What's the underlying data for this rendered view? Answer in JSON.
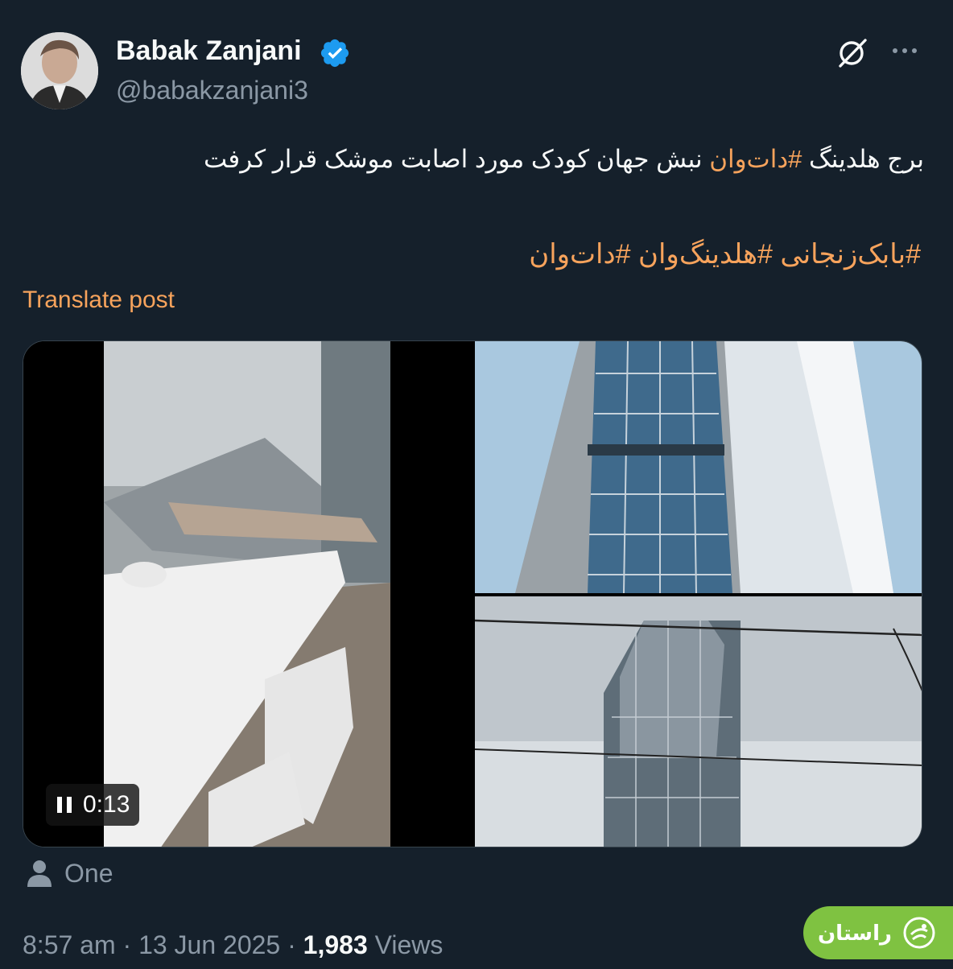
{
  "author": {
    "display_name": "Babak Zanjani",
    "handle": "@babakzanjani3",
    "verified": true
  },
  "header_icons": [
    "grok-icon",
    "more-icon"
  ],
  "post": {
    "line1_text": "برج  هلدینگ ",
    "line1_hashtag": "#دات‌وان",
    "line1_rest": " نبش جهان کودک مورد اصابت  موشک  قرار کرفت",
    "hashtags": "#بابک‌زنجانی #هلدینگ‌وان #دات‌وان",
    "translate_label": "Translate post"
  },
  "media": {
    "video_time": "0:13",
    "video_state": "playing"
  },
  "tagged": {
    "label": "One"
  },
  "meta": {
    "time": "8:57 am",
    "sep1": " · ",
    "date": "13 Jun 2025",
    "sep2": " · ",
    "views_count": "1,983",
    "views_label": " Views"
  },
  "watermark": {
    "text": "راستان"
  },
  "colors": {
    "background": "#15202b",
    "accent": "#f7a35c",
    "secondary_text": "#8b98a5",
    "verified": "#1d9bf0",
    "watermark": "#7fc241"
  }
}
